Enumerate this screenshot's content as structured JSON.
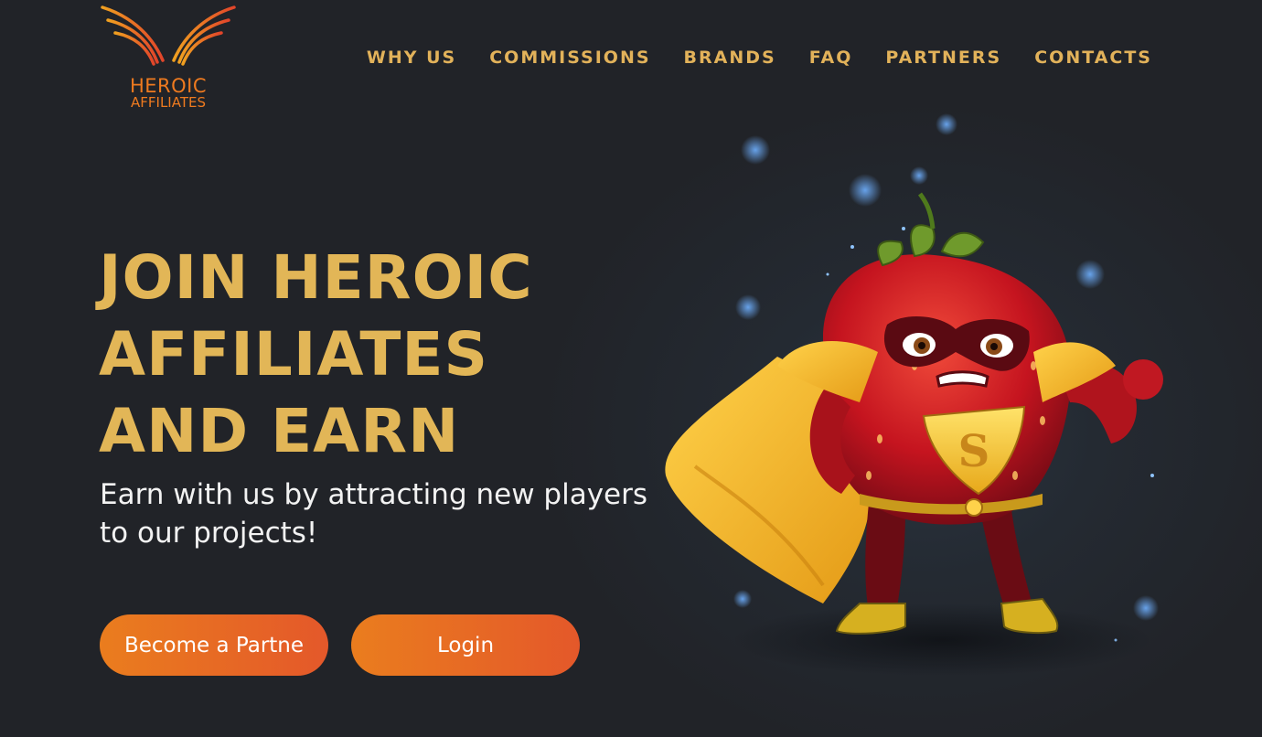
{
  "brand": {
    "name_line1": "HEROIC",
    "name_line2": "AFFILIATES",
    "logo_icon": "wings-icon",
    "accent_color": "#ee7a1f"
  },
  "nav": {
    "items": [
      {
        "label": "WHY US"
      },
      {
        "label": "COMMISSIONS"
      },
      {
        "label": "BRANDS"
      },
      {
        "label": "FAQ"
      },
      {
        "label": "PARTNERS"
      },
      {
        "label": "CONTACTS"
      }
    ],
    "color": "#e2b25a"
  },
  "hero": {
    "headline_lines": [
      "JOIN HEROIC",
      "AFFILIATES",
      "AND EARN"
    ],
    "subtitle_lines": [
      "Earn with us by attracting new players",
      "to our projects!"
    ],
    "primary_button": "Become a Partne",
    "secondary_button": "Login",
    "illustration": "superhero-strawberry-mascot",
    "headline_color": "#e2b657",
    "button_gradient": [
      "#ea7d1e",
      "#e4582a"
    ]
  }
}
